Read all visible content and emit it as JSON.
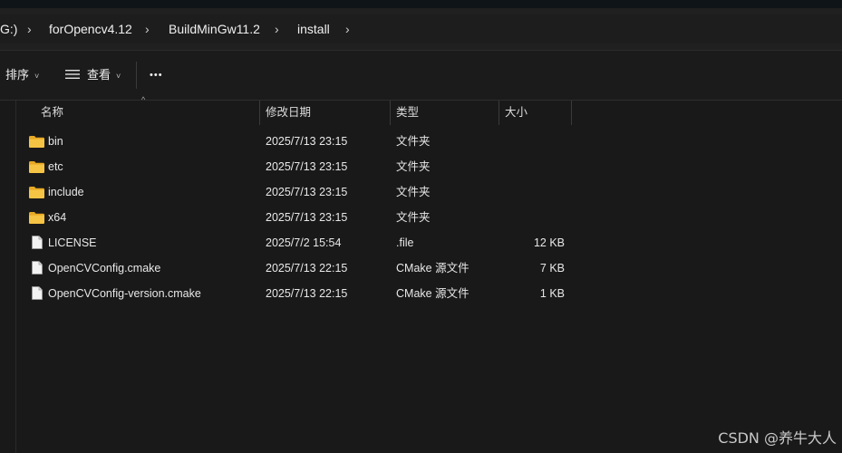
{
  "breadcrumb": {
    "items": [
      "G:)",
      "forOpencv4.12",
      "BuildMinGw11.2",
      "install"
    ]
  },
  "toolbar": {
    "sort_label": "排序",
    "view_label": "查看",
    "more_label": "•••"
  },
  "columns": {
    "name": "名称",
    "date": "修改日期",
    "type": "类型",
    "size": "大小"
  },
  "files": [
    {
      "name": "bin",
      "date": "2025/7/13 23:15",
      "type": "文件夹",
      "size": "",
      "icon": "folder-icon"
    },
    {
      "name": "etc",
      "date": "2025/7/13 23:15",
      "type": "文件夹",
      "size": "",
      "icon": "folder-icon"
    },
    {
      "name": "include",
      "date": "2025/7/13 23:15",
      "type": "文件夹",
      "size": "",
      "icon": "folder-icon"
    },
    {
      "name": "x64",
      "date": "2025/7/13 23:15",
      "type": "文件夹",
      "size": "",
      "icon": "folder-icon"
    },
    {
      "name": "LICENSE",
      "date": "2025/7/2 15:54",
      "type": ".file",
      "size": "12 KB",
      "icon": "file-icon"
    },
    {
      "name": "OpenCVConfig.cmake",
      "date": "2025/7/13 22:15",
      "type": "CMake 源文件",
      "size": "7 KB",
      "icon": "file-icon"
    },
    {
      "name": "OpenCVConfig-version.cmake",
      "date": "2025/7/13 22:15",
      "type": "CMake 源文件",
      "size": "1 KB",
      "icon": "file-icon"
    }
  ],
  "watermark": "CSDN @养牛大人",
  "colors": {
    "background": "#191919",
    "folder": "#f4c043",
    "text": "#e8e8e8"
  }
}
